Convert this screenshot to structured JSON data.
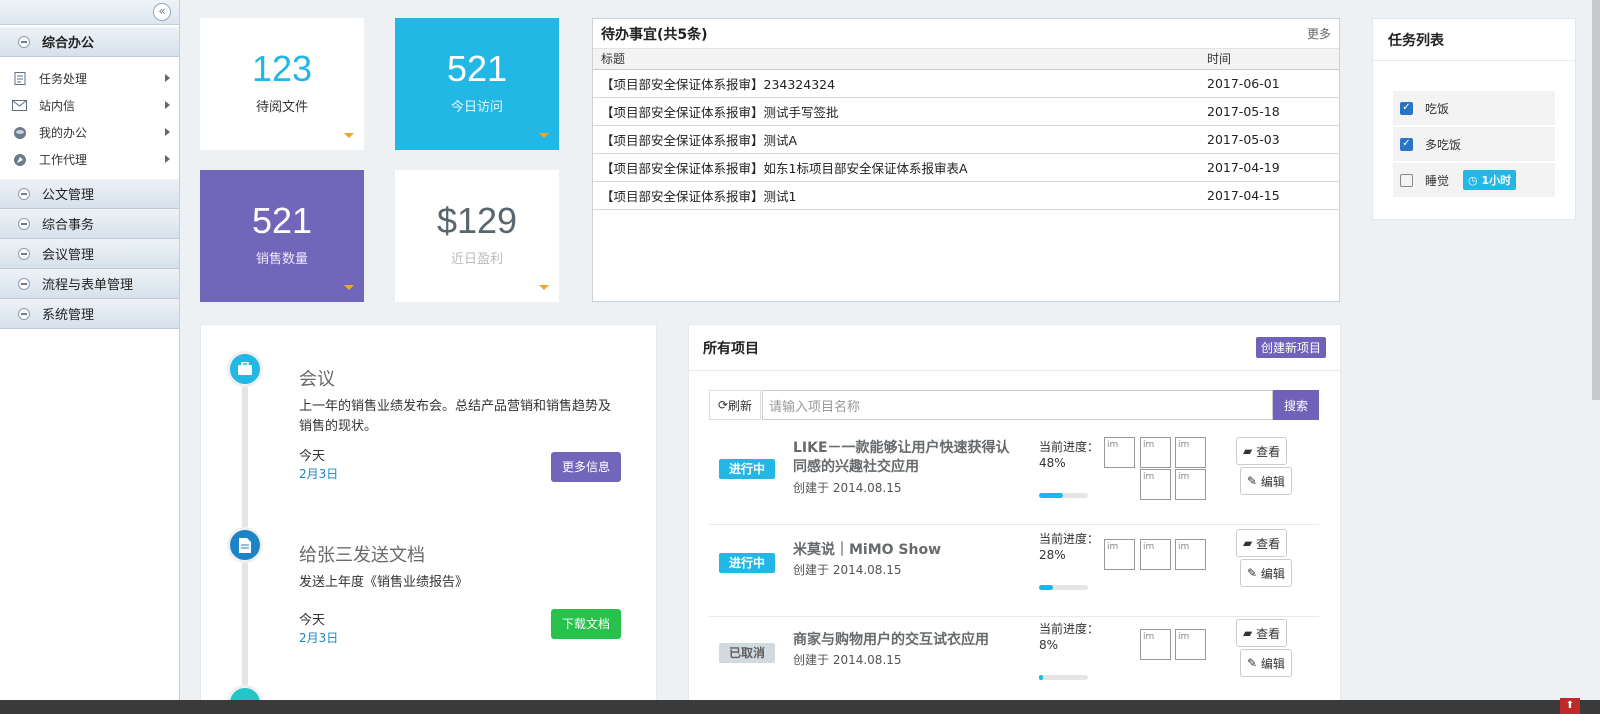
{
  "sidebar": {
    "collapse_icon": "double-chevron-left",
    "open_section": "综合办公",
    "items": [
      {
        "label": "任务处理",
        "icon": "doc-icon"
      },
      {
        "label": "站内信",
        "icon": "mail-icon"
      },
      {
        "label": "我的办公",
        "icon": "disk-icon"
      },
      {
        "label": "工作代理",
        "icon": "rocket-icon"
      }
    ],
    "sections": [
      "公文管理",
      "综合事务",
      "会议管理",
      "流程与表单管理",
      "系统管理"
    ]
  },
  "stats": [
    {
      "value": "123",
      "label": "待阅文件",
      "bg": "#ffffff",
      "color": "#23b7e5",
      "labelColor": "#333333"
    },
    {
      "value": "521",
      "label": "今日访问",
      "bg": "#23b7e5",
      "color": "#ffffff",
      "labelColor": "#e6f7fc"
    },
    {
      "value": "521",
      "label": "销售数量",
      "bg": "#7266ba",
      "color": "#ffffff",
      "labelColor": "#ece9f7"
    },
    {
      "value": "$129",
      "label": "近日盈利",
      "bg": "#ffffff",
      "color": "#58666e",
      "labelColor": "#bbbbbb"
    }
  ],
  "todo": {
    "title": "待办事宜(共5条)",
    "more": "更多",
    "col_title": "标题",
    "col_time": "时间",
    "rows": [
      {
        "title": "【项目部安全保证体系报审】234324324",
        "time": "2017-06-01"
      },
      {
        "title": "【项目部安全保证体系报审】测试手写签批",
        "time": "2017-05-18"
      },
      {
        "title": "【项目部安全保证体系报审】测试A",
        "time": "2017-05-03"
      },
      {
        "title": "【项目部安全保证体系报审】如东1标项目部安全保证体系报审表A",
        "time": "2017-04-19"
      },
      {
        "title": "【项目部安全保证体系报审】测试1",
        "time": "2017-04-15"
      }
    ]
  },
  "tasks": {
    "title": "任务列表",
    "items": [
      {
        "label": "吃饭",
        "checked": true,
        "badge": ""
      },
      {
        "label": "多吃饭",
        "checked": true,
        "badge": ""
      },
      {
        "label": "睡觉",
        "checked": false,
        "badge": "1小时"
      }
    ]
  },
  "timeline": [
    {
      "title": "会议",
      "body": "上一年的销售业绩发布会。总结产品营销和销售趋势及销售的现状。",
      "day": "今天",
      "date": "2月3日",
      "button": "更多信息",
      "btnColor": "#7266ba",
      "iconColor": "#23b7e5",
      "icon": "briefcase-icon"
    },
    {
      "title": "给张三发送文档",
      "body": "发送上年度《销售业绩报告》",
      "day": "今天",
      "date": "2月3日",
      "button": "下载文档",
      "btnColor": "#27c24c",
      "iconColor": "#1c84c6",
      "icon": "file-icon"
    }
  ],
  "projects": {
    "title": "所有项目",
    "new_button": "创建新项目",
    "refresh": "刷新",
    "search_placeholder": "请输入项目名称",
    "search_button": "搜索",
    "progress_label": "当前进度：",
    "view_label": "查看",
    "edit_label": "编辑",
    "avatar_alt": "im",
    "rows": [
      {
        "status": "进行中",
        "statusColor": "#23b7e5",
        "name": "LIKE－一款能够让用户快速获得认同感的兴趣社交应用",
        "created": "创建于 2014.08.15",
        "progress": "48%",
        "progress_value": 48,
        "avatars": 5
      },
      {
        "status": "进行中",
        "statusColor": "#23b7e5",
        "name": "米莫说｜MiMO Show",
        "created": "创建于 2014.08.15",
        "progress": "28%",
        "progress_value": 28,
        "avatars": 3
      },
      {
        "status": "已取消",
        "statusColor": "#d1dade",
        "name": "商家与购物用户的交互试衣应用",
        "created": "创建于 2014.08.15",
        "progress": "8%",
        "progress_value": 8,
        "avatars": 2
      }
    ]
  }
}
